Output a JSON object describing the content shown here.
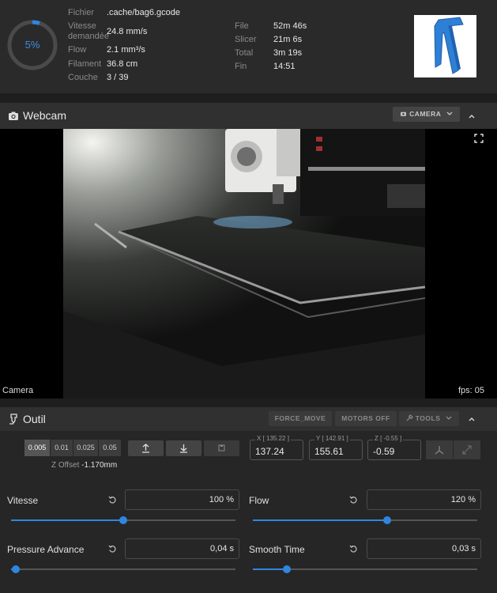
{
  "status": {
    "progress_percent": 5,
    "progress_label": "5%",
    "left": [
      {
        "label": "Fichier",
        "value": ".cache/bag6.gcode"
      },
      {
        "label": "Vitesse demandée",
        "value": "24.8 mm/s"
      },
      {
        "label": "Flow",
        "value": "2.1 mm³/s"
      },
      {
        "label": "Filament",
        "value": "36.8 cm"
      },
      {
        "label": "Couche",
        "value": "3 / 39"
      }
    ],
    "right": [
      {
        "label": "File",
        "value": "52m 46s"
      },
      {
        "label": "Slicer",
        "value": "21m 6s"
      },
      {
        "label": "Total",
        "value": "3m 19s"
      },
      {
        "label": "Fin",
        "value": "14:51"
      }
    ],
    "colors": {
      "accent": "#2e86e0",
      "model": "#2e7fd6"
    }
  },
  "webcam": {
    "title": "Webcam",
    "camera_button": "CAMERA",
    "camera_name": "Camera",
    "fps": "fps: 05"
  },
  "tool": {
    "title": "Outil",
    "buttons": {
      "force_move": "FORCE_MOVE",
      "motors_off": "MOTORS OFF",
      "tools": "TOOLS"
    },
    "steps": [
      "0.005",
      "0.01",
      "0.025",
      "0.05"
    ],
    "active_step": "0.005",
    "zoffset_label": "Z Offset",
    "zoffset_value": "-1.170mm",
    "coords": {
      "x": {
        "label": "X [ 135.22 ]",
        "value": "137.24"
      },
      "y": {
        "label": "Y [ 142.91 ]",
        "value": "155.61"
      },
      "z": {
        "label": "Z [ -0.55 ]",
        "value": "-0.59"
      }
    },
    "sliders": {
      "speed": {
        "label": "Vitesse",
        "value": "100 %",
        "fraction": 0.5
      },
      "flow": {
        "label": "Flow",
        "value": "120 %",
        "fraction": 0.6
      },
      "pressure": {
        "label": "Pressure Advance",
        "value": "0,04 s",
        "fraction": 0.02
      },
      "smooth": {
        "label": "Smooth Time",
        "value": "0,03 s",
        "fraction": 0.15
      }
    }
  }
}
